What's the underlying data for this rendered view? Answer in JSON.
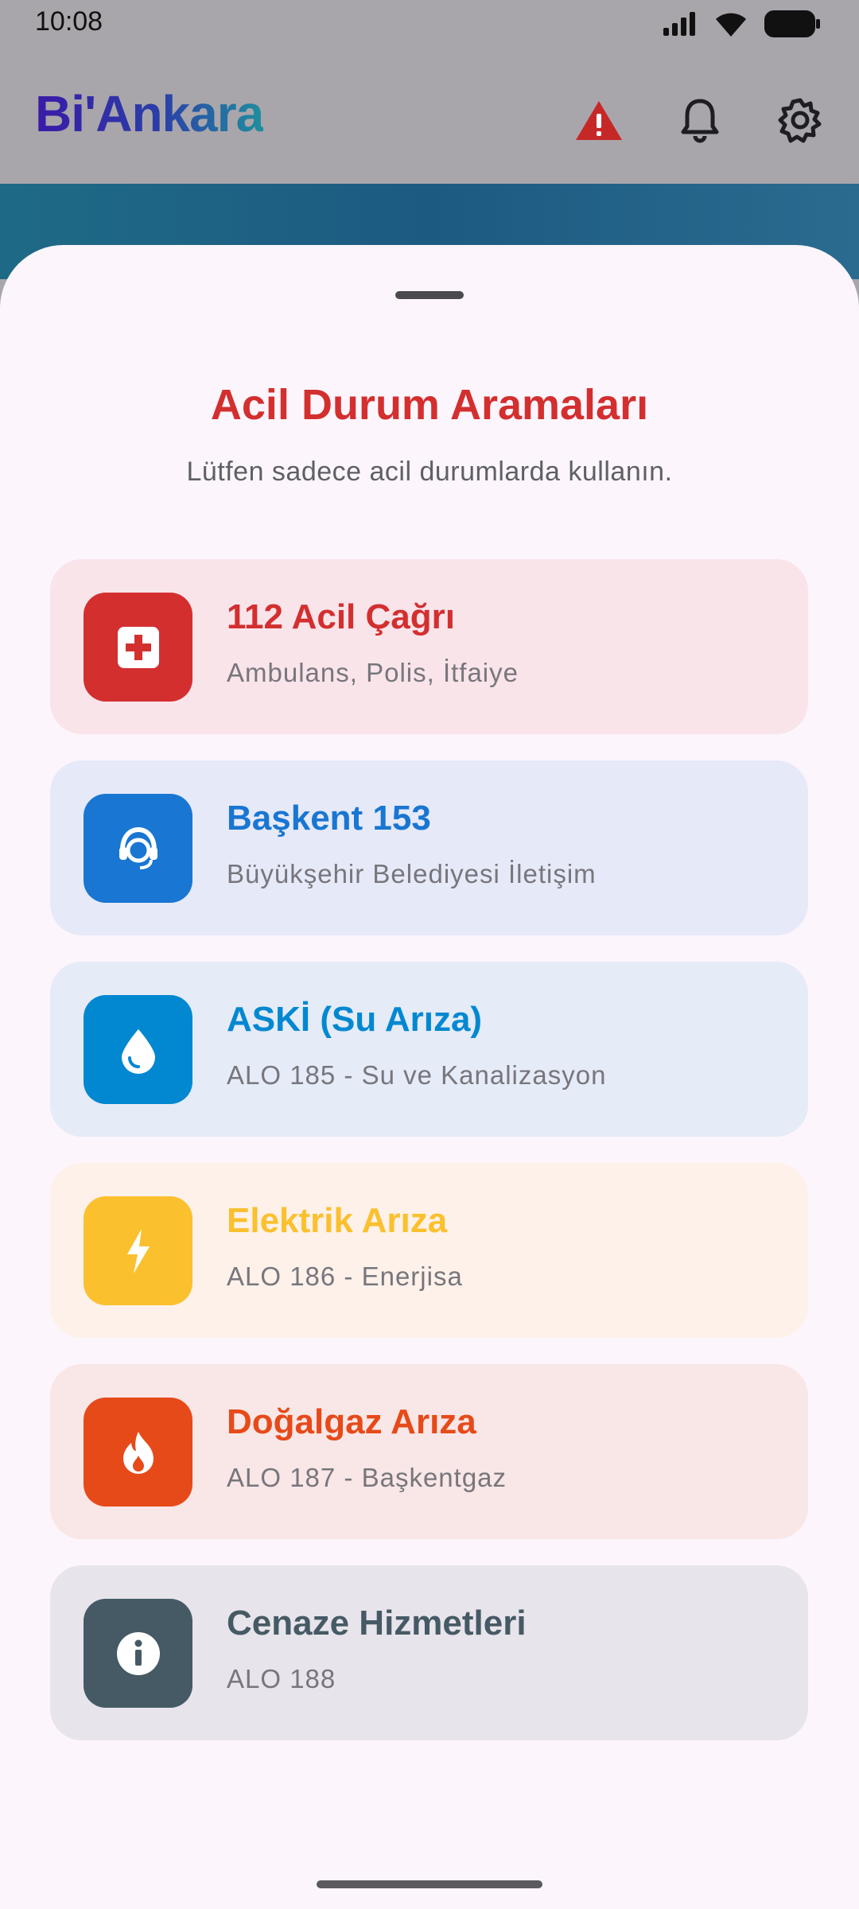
{
  "status_bar": {
    "time": "10:08"
  },
  "app_bar": {
    "logo": "Bi'Ankara",
    "actions": [
      {
        "name": "warning-icon",
        "color": "#c62828"
      },
      {
        "name": "bell-icon"
      },
      {
        "name": "gear-icon"
      }
    ]
  },
  "sheet": {
    "title": "Acil Durum Aramaları",
    "subtitle": "Lütfen sadece acil durumlarda kullanın.",
    "items": [
      {
        "title": "112 Acil Çağrı",
        "subtitle": "Ambulans, Polis, İtfaiye",
        "icon": "first-aid-icon",
        "accent": "#d32f2f",
        "bg": "#f9e4ea"
      },
      {
        "title": "Başkent 153",
        "subtitle": "Büyükşehir Belediyesi İletişim",
        "icon": "support-agent-icon",
        "accent": "#1976d2",
        "bg": "#e6e9f8"
      },
      {
        "title": "ASKİ (Su Arıza)",
        "subtitle": "ALO 185 - Su ve Kanalizasyon",
        "icon": "water-drop-icon",
        "accent": "#0288d1",
        "bg": "#e5ebf7"
      },
      {
        "title": "Elektrik Arıza",
        "subtitle": "ALO 186 - Enerjisa",
        "icon": "bolt-icon",
        "accent": "#fbc02d",
        "bg": "#fdf1ea"
      },
      {
        "title": "Doğalgaz Arıza",
        "subtitle": "ALO 187 - Başkentgaz",
        "icon": "flame-icon",
        "accent": "#e64a19",
        "bg": "#f9e6e6"
      },
      {
        "title": "Cenaze Hizmetleri",
        "subtitle": "ALO 188",
        "icon": "info-icon",
        "accent": "#455a64",
        "bg": "#e8e4eb"
      }
    ]
  }
}
